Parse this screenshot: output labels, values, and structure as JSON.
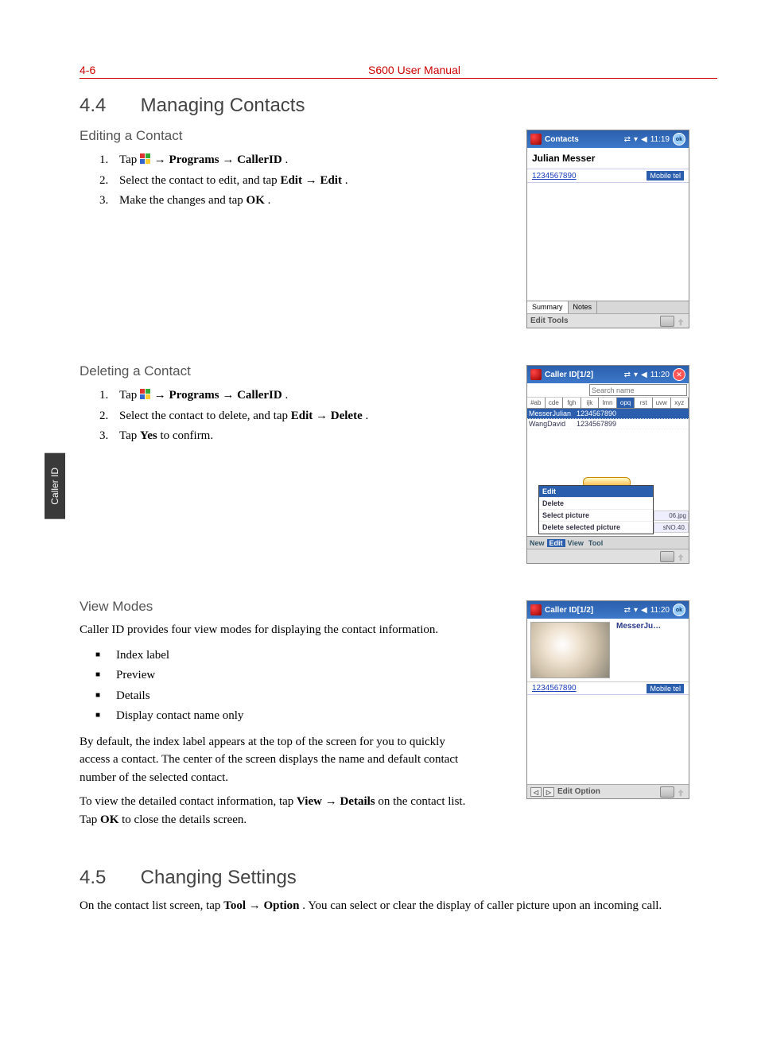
{
  "header": {
    "page_num": "4-6",
    "manual_title": "S600 User Manual"
  },
  "side_tab": "Caller ID",
  "sec44": {
    "number": "4.4",
    "title": "Managing Contacts",
    "edit": {
      "heading": "Editing a Contact",
      "step1a": "Tap ",
      "step1b": "→ Programs → CallerID",
      "step1c": ".",
      "step2a": "Select the contact to edit, and tap ",
      "step2b": "Edit → Edit",
      "step2c": ".",
      "step3a": "Make the changes and tap ",
      "step3b": "OK",
      "step3c": "."
    },
    "delete": {
      "heading": "Deleting a Contact",
      "step1a": "Tap ",
      "step1b": "→ Programs → CallerID",
      "step1c": ".",
      "step2a": "Select the contact to delete, and tap ",
      "step2b": "Edit → Delete",
      "step2c": ".",
      "step3a": "Tap ",
      "step3b": "Yes",
      "step3c": " to confirm."
    },
    "view": {
      "heading": "View Modes",
      "intro": "Caller ID provides four view modes for displaying the contact information.",
      "b1": "Index label",
      "b2": "Preview",
      "b3": "Details",
      "b4": "Display contact name only",
      "p1": "By default, the index label appears at the top of the screen for you to quickly access a contact. The center of the screen displays the name and default contact number of the selected contact.",
      "p2a": "To view the detailed contact information, tap ",
      "p2b": "View → Details",
      "p2c": " on the contact list. Tap ",
      "p2d": "OK",
      "p2e": " to close the details screen."
    }
  },
  "sec45": {
    "number": "4.5",
    "title": "Changing Settings",
    "p1a": "On the contact list screen, tap ",
    "p1b": "Tool → Option",
    "p1c": ". You can select or clear the display of caller picture upon an incoming call."
  },
  "shot1": {
    "title": "Contacts",
    "time": "11:19",
    "ok": "ok",
    "name": "Julian Messer",
    "phone": "1234567890",
    "label": "Mobile tel",
    "tab1": "Summary",
    "tab2": "Notes",
    "footer": "Edit Tools"
  },
  "shot2": {
    "title": "Caller ID[1/2]",
    "time": "11:20",
    "search_ph": "Search name",
    "idx": [
      "#ab",
      "cde",
      "fgh",
      "ijk",
      "lmn",
      "opq",
      "rst",
      "uvw",
      "xyz"
    ],
    "row1n": "MesserJulian",
    "row1p": "1234567890",
    "row2n": "WangDavid",
    "row2p": "1234567899",
    "side1": "06.jpg",
    "side2": "sNO.40.",
    "menu": {
      "m1": "Edit",
      "m2": "Delete",
      "m3": "Select picture",
      "m4": "Delete selected picture"
    },
    "footer": {
      "f1": "New",
      "f2": "Edit",
      "f3": "View",
      "f4": "Tool"
    }
  },
  "shot3": {
    "title": "Caller ID[1/2]",
    "time": "11:20",
    "ok": "ok",
    "name": "MesserJu…",
    "phone": "1234567890",
    "label": "Mobile tel",
    "footer": "Edit Option"
  }
}
